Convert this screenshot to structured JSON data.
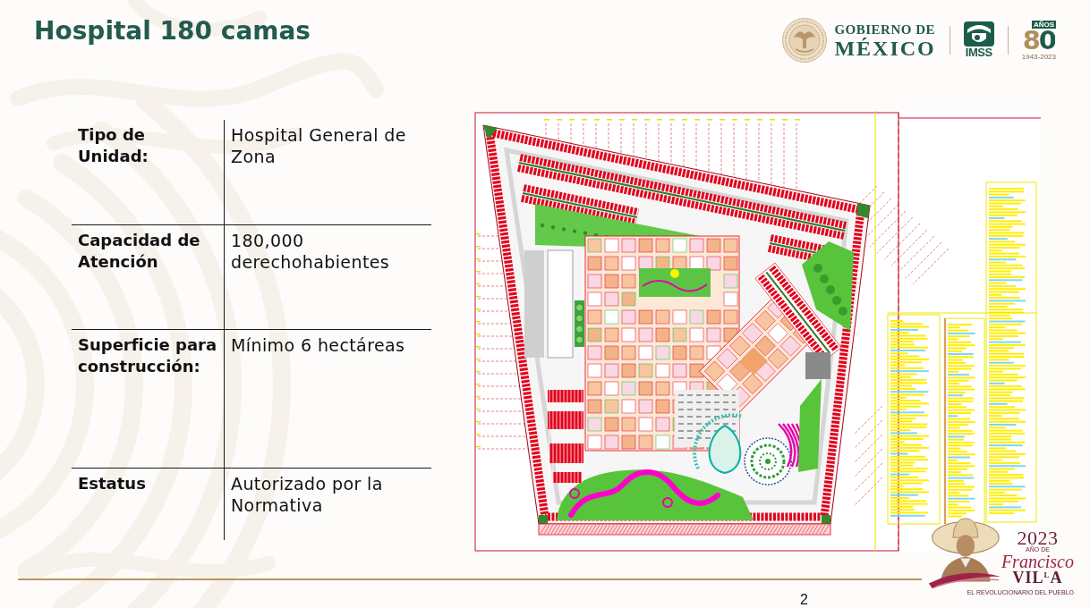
{
  "header": {
    "title": "Hospital 180 camas",
    "government_logo": {
      "line_1": "GOBIERNO DE",
      "line_2": "MÉXICO"
    },
    "imss_logo": {
      "label": "IMSS"
    },
    "anniversary_logo": {
      "badge": "AÑOS",
      "number": "80",
      "years": "1943-2023"
    }
  },
  "table": {
    "rows": [
      {
        "label": "Tipo de\nUnidad:",
        "value": "Hospital General de\nZona"
      },
      {
        "label": "Capacidad de\nAtención",
        "value": "180,000\nderechohabientes"
      },
      {
        "label": "Superficie para\nconstrucción:",
        "value": "Mínimo 6 hectáreas"
      },
      {
        "label": "Estatus",
        "value": "Autorizado por la\nNormativa"
      }
    ]
  },
  "commemorative_logo": {
    "year": "2023",
    "caption": "AÑO DE",
    "name_first": "Francisco",
    "name_last": "VIL$^{L}$A",
    "motto": "EL REVOLUCIONARIO DEL PUEBLO"
  },
  "footer": {
    "page_number": "2"
  }
}
